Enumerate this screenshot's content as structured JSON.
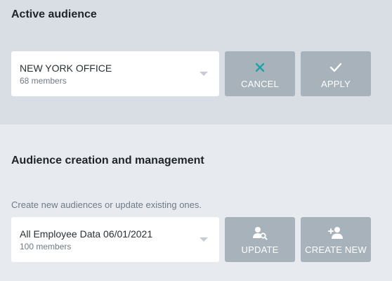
{
  "active": {
    "heading": "Active audience",
    "select": {
      "title": "NEW YORK OFFICE",
      "sub": "68 members"
    },
    "cancel_label": "CANCEL",
    "apply_label": "APPLY",
    "cancel_icon_color": "#1aa3a8"
  },
  "management": {
    "heading": "Audience creation and management",
    "description": "Create new audiences or update existing ones.",
    "select": {
      "title": "All Employee Data 06/01/2021",
      "sub": "100 members"
    },
    "update_label": "UPDATE",
    "create_label": "CREATE NEW"
  },
  "icons": {
    "cancel": "close-icon",
    "apply": "check-icon",
    "update": "user-search-icon",
    "create": "add-user-icon"
  }
}
